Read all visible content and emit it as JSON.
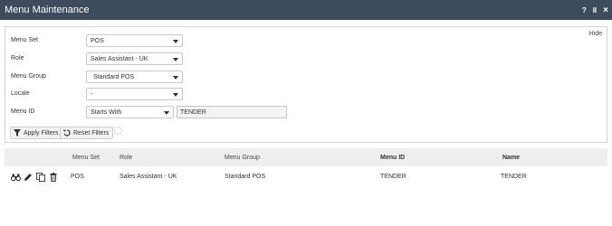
{
  "window": {
    "title": "Menu Maintenance",
    "controls": {
      "help": "?",
      "pause": "II",
      "close": "×"
    }
  },
  "filters": {
    "hide_label": "Hide",
    "menu_set": {
      "label": "Menu Set",
      "value": "POS"
    },
    "role": {
      "label": "Role",
      "value": "Sales Assistant - UK"
    },
    "menu_group": {
      "label": "Menu Group",
      "value": "Standard POS"
    },
    "locale": {
      "label": "Locale",
      "value": "-"
    },
    "menu_id": {
      "label": "Menu ID",
      "operator": "Starts With",
      "value": "TENDER"
    },
    "apply_label": "Apply Filters",
    "reset_label": "Reset Filters"
  },
  "grid": {
    "columns": [
      "Menu Set",
      "Role",
      "Menu Group",
      "Menu ID",
      "Name"
    ],
    "rows": [
      {
        "menu_set": "POS",
        "role": "Sales Assistant - UK",
        "menu_group": "Standard POS",
        "menu_id": "TENDER",
        "name": "TENDER"
      }
    ]
  }
}
